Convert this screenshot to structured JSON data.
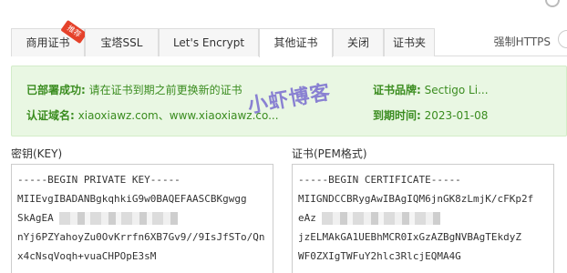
{
  "tabs": [
    {
      "label": "商用证书",
      "ribbon": "推荐"
    },
    {
      "label": "宝塔SSL"
    },
    {
      "label": "Let's Encrypt"
    },
    {
      "label": "其他证书"
    },
    {
      "label": "关闭"
    },
    {
      "label": "证书夹"
    }
  ],
  "force_https_label": "强制HTTPS",
  "info": {
    "deploy_label": "已部署成功:",
    "deploy_value": "请在证书到期之前更换新的证书",
    "domain_label": "认证域名:",
    "domain_value": "xiaoxiawz.com、www.xiaoxiawz.co...",
    "brand_label": "证书品牌:",
    "brand_value": "Sectigo Li...",
    "expire_label": "到期时间:",
    "expire_value": "2023-01-08"
  },
  "watermark": "小虾博客",
  "key": {
    "label": "密钥(KEY)",
    "lines": [
      "-----BEGIN PRIVATE KEY-----",
      "MIIEvgIBADANBgkqhkiG9w0BAQEFAASCBKgwgg",
      "SkAgEA",
      "nYj6PZYahoyZu0OvKrrfn6XB7Gv9//9IsJfSTo/Qn",
      "x4cNsqVoqh+vuaCHPOpE3sM"
    ]
  },
  "cert": {
    "label": "证书(PEM格式)",
    "lines": [
      "-----BEGIN CERTIFICATE-----",
      "MIIGNDCCBRygAwIBAgIQM6jnGK8zLmjK/cFKp2f",
      "eAz",
      "jzELMAkGA1UEBhMCR0IxGzAZBgNVBAgTEkdyZ",
      "WF0ZXIgTWFuY2hlc3RlcjEQMA4G"
    ]
  }
}
